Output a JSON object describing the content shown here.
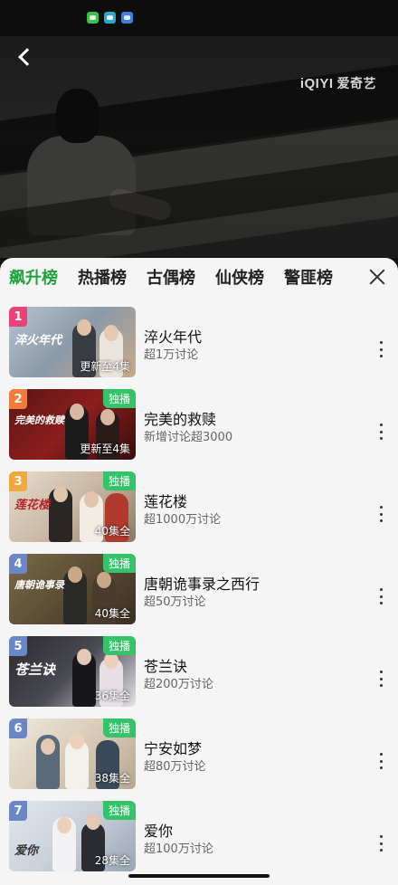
{
  "video": {
    "brand_latin": "iQIYI",
    "brand_cn": "爱奇艺"
  },
  "tabs": [
    "飙升榜",
    "热播榜",
    "古偶榜",
    "仙侠榜",
    "警匪榜"
  ],
  "colors": {
    "accent": "#1fa33b",
    "exclusive_badge": "#35c36a"
  },
  "icons": [
    "back-icon",
    "close-icon",
    "more-icon"
  ],
  "items": [
    {
      "rank": "1",
      "rank_color": "#e9437a",
      "title": "淬火年代",
      "sub": "超1万讨论",
      "episodes": "更新至4集",
      "exclusive": "",
      "poster_text": "淬火年代"
    },
    {
      "rank": "2",
      "rank_color": "#f07b3a",
      "title": "完美的救赎",
      "sub": "新增讨论超3000",
      "episodes": "更新至4集",
      "exclusive": "独播",
      "poster_text": "完美的救赎"
    },
    {
      "rank": "3",
      "rank_color": "#f0a93a",
      "title": "莲花楼",
      "sub": "超1000万讨论",
      "episodes": "40集全",
      "exclusive": "独播",
      "poster_text": "莲花楼"
    },
    {
      "rank": "4",
      "rank_color": "#6a88c8",
      "title": "唐朝诡事录之西行",
      "sub": "超50万讨论",
      "episodes": "40集全",
      "exclusive": "独播",
      "poster_text": "唐朝诡事录"
    },
    {
      "rank": "5",
      "rank_color": "#6a88c8",
      "title": "苍兰诀",
      "sub": "超200万讨论",
      "episodes": "36集全",
      "exclusive": "独播",
      "poster_text": "苍兰诀"
    },
    {
      "rank": "6",
      "rank_color": "#6a88c8",
      "title": "宁安如梦",
      "sub": "超80万讨论",
      "episodes": "38集全",
      "exclusive": "独播",
      "poster_text": ""
    },
    {
      "rank": "7",
      "rank_color": "#6a88c8",
      "title": "爱你",
      "sub": "超100万讨论",
      "episodes": "28集全",
      "exclusive": "独播",
      "poster_text": "爱你"
    }
  ]
}
